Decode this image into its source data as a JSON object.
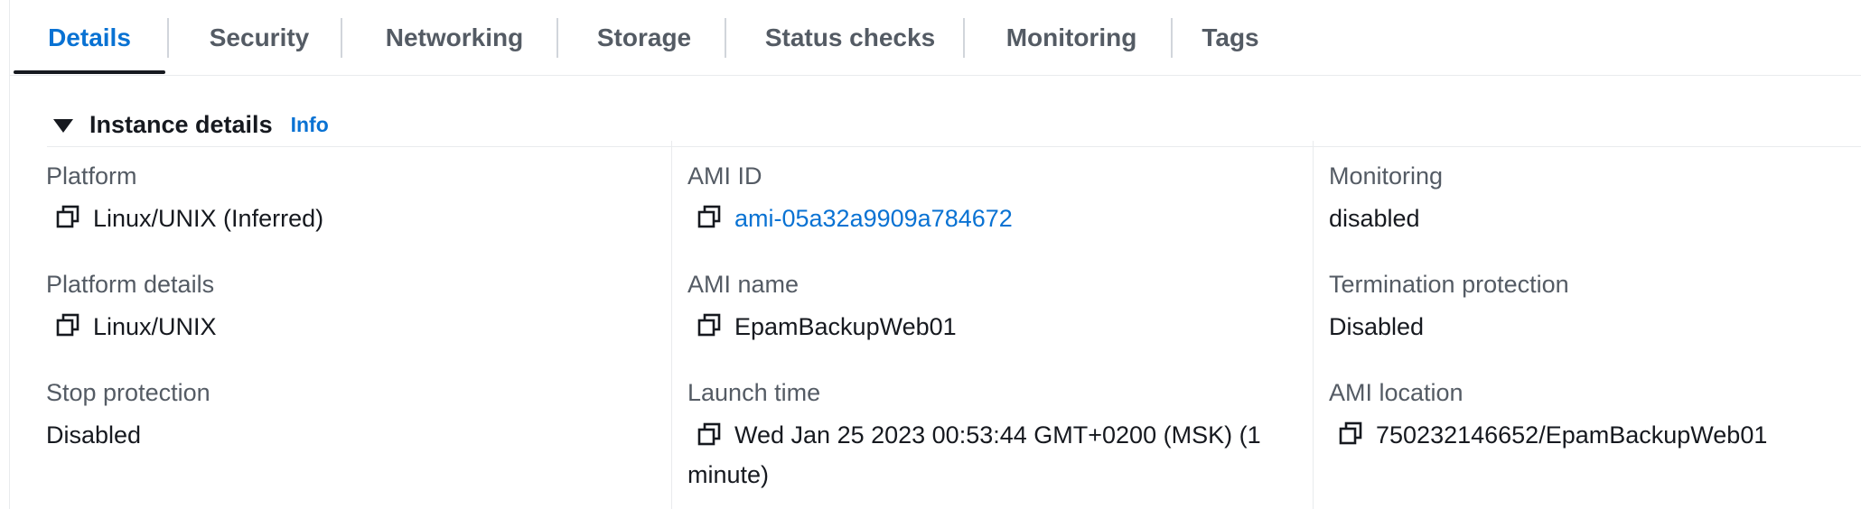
{
  "tabs": [
    {
      "label": "Details",
      "active": true
    },
    {
      "label": "Security",
      "active": false
    },
    {
      "label": "Networking",
      "active": false
    },
    {
      "label": "Storage",
      "active": false
    },
    {
      "label": "Status checks",
      "active": false
    },
    {
      "label": "Monitoring",
      "active": false
    },
    {
      "label": "Tags",
      "active": false
    }
  ],
  "section": {
    "title": "Instance details",
    "info_label": "Info"
  },
  "fields": {
    "platform": {
      "label": "Platform",
      "value": "Linux/UNIX (Inferred)"
    },
    "platform_details": {
      "label": "Platform details",
      "value": "Linux/UNIX"
    },
    "stop_protection": {
      "label": "Stop protection",
      "value": "Disabled"
    },
    "ami_id": {
      "label": "AMI ID",
      "value": "ami-05a32a9909a784672"
    },
    "ami_name": {
      "label": "AMI name",
      "value": "EpamBackupWeb01"
    },
    "launch_time": {
      "label": "Launch time",
      "value": "Wed Jan 25 2023 00:53:44 GMT+0200 (MSK) (1 minute)"
    },
    "monitoring": {
      "label": "Monitoring",
      "value": "disabled"
    },
    "termination_protection": {
      "label": "Termination protection",
      "value": "Disabled"
    },
    "ami_location": {
      "label": "AMI location",
      "value": "750232146652/EpamBackupWeb01"
    }
  },
  "colors": {
    "accent": "#0972d3",
    "text": "#16191f",
    "label": "#545b64",
    "divider": "#e9ebed"
  },
  "icons": {
    "copy": "copy-icon",
    "caret": "caret-down-icon"
  }
}
